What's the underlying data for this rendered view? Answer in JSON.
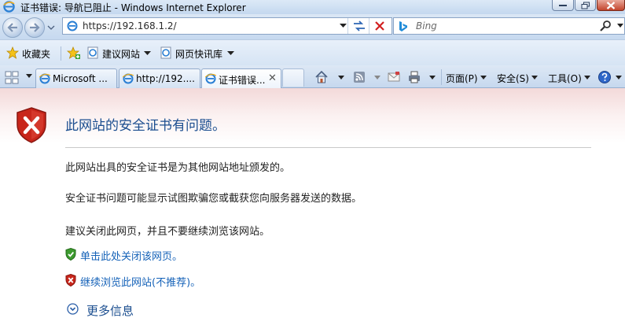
{
  "window": {
    "title": "证书错误: 导航已阻止 - Windows Internet Explorer"
  },
  "address_bar": {
    "url": "https://192.168.1.2/"
  },
  "search": {
    "placeholder": "Bing"
  },
  "favorites_bar": {
    "favorites_label": "收藏夹",
    "items": [
      {
        "label": "建议网站"
      },
      {
        "label": "网页快讯库"
      }
    ]
  },
  "tabs": [
    {
      "label": "Microsoft ..."
    },
    {
      "label": "http://192...."
    },
    {
      "label": "证书错误..."
    }
  ],
  "tab_close_glyph": "✕",
  "command_bar": {
    "page_label": "页面(P)",
    "safety_label": "安全(S)",
    "tools_label": "工具(O)"
  },
  "content": {
    "title": "此网站的安全证书有问题。",
    "paragraph1": "此网站出具的安全证书是为其他网站地址颁发的。",
    "paragraph2": "安全证书问题可能显示试图欺骗您或截获您向服务器发送的数据。",
    "paragraph3": "建议关闭此网页，并且不要继续浏览该网站。",
    "close_link": "单击此处关闭该网页。",
    "continue_link": "继续浏览此网站(不推荐)。",
    "more_info": "更多信息"
  },
  "colors": {
    "title_blue": "#1a4d8f",
    "link_blue": "#1562b8",
    "shield_red": "#c8261b",
    "shield_green": "#3d9b2f"
  }
}
